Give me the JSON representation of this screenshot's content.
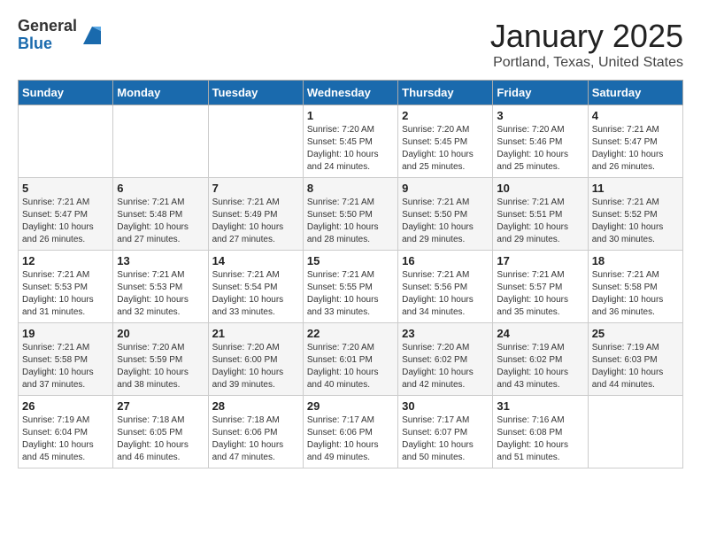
{
  "logo": {
    "general": "General",
    "blue": "Blue"
  },
  "title": "January 2025",
  "location": "Portland, Texas, United States",
  "days_of_week": [
    "Sunday",
    "Monday",
    "Tuesday",
    "Wednesday",
    "Thursday",
    "Friday",
    "Saturday"
  ],
  "weeks": [
    [
      {
        "day": "",
        "info": ""
      },
      {
        "day": "",
        "info": ""
      },
      {
        "day": "",
        "info": ""
      },
      {
        "day": "1",
        "sunrise": "7:20 AM",
        "sunset": "5:45 PM",
        "daylight": "10 hours and 24 minutes."
      },
      {
        "day": "2",
        "sunrise": "7:20 AM",
        "sunset": "5:45 PM",
        "daylight": "10 hours and 25 minutes."
      },
      {
        "day": "3",
        "sunrise": "7:20 AM",
        "sunset": "5:46 PM",
        "daylight": "10 hours and 25 minutes."
      },
      {
        "day": "4",
        "sunrise": "7:21 AM",
        "sunset": "5:47 PM",
        "daylight": "10 hours and 26 minutes."
      }
    ],
    [
      {
        "day": "5",
        "sunrise": "7:21 AM",
        "sunset": "5:47 PM",
        "daylight": "10 hours and 26 minutes."
      },
      {
        "day": "6",
        "sunrise": "7:21 AM",
        "sunset": "5:48 PM",
        "daylight": "10 hours and 27 minutes."
      },
      {
        "day": "7",
        "sunrise": "7:21 AM",
        "sunset": "5:49 PM",
        "daylight": "10 hours and 27 minutes."
      },
      {
        "day": "8",
        "sunrise": "7:21 AM",
        "sunset": "5:50 PM",
        "daylight": "10 hours and 28 minutes."
      },
      {
        "day": "9",
        "sunrise": "7:21 AM",
        "sunset": "5:50 PM",
        "daylight": "10 hours and 29 minutes."
      },
      {
        "day": "10",
        "sunrise": "7:21 AM",
        "sunset": "5:51 PM",
        "daylight": "10 hours and 29 minutes."
      },
      {
        "day": "11",
        "sunrise": "7:21 AM",
        "sunset": "5:52 PM",
        "daylight": "10 hours and 30 minutes."
      }
    ],
    [
      {
        "day": "12",
        "sunrise": "7:21 AM",
        "sunset": "5:53 PM",
        "daylight": "10 hours and 31 minutes."
      },
      {
        "day": "13",
        "sunrise": "7:21 AM",
        "sunset": "5:53 PM",
        "daylight": "10 hours and 32 minutes."
      },
      {
        "day": "14",
        "sunrise": "7:21 AM",
        "sunset": "5:54 PM",
        "daylight": "10 hours and 33 minutes."
      },
      {
        "day": "15",
        "sunrise": "7:21 AM",
        "sunset": "5:55 PM",
        "daylight": "10 hours and 33 minutes."
      },
      {
        "day": "16",
        "sunrise": "7:21 AM",
        "sunset": "5:56 PM",
        "daylight": "10 hours and 34 minutes."
      },
      {
        "day": "17",
        "sunrise": "7:21 AM",
        "sunset": "5:57 PM",
        "daylight": "10 hours and 35 minutes."
      },
      {
        "day": "18",
        "sunrise": "7:21 AM",
        "sunset": "5:58 PM",
        "daylight": "10 hours and 36 minutes."
      }
    ],
    [
      {
        "day": "19",
        "sunrise": "7:21 AM",
        "sunset": "5:58 PM",
        "daylight": "10 hours and 37 minutes."
      },
      {
        "day": "20",
        "sunrise": "7:20 AM",
        "sunset": "5:59 PM",
        "daylight": "10 hours and 38 minutes."
      },
      {
        "day": "21",
        "sunrise": "7:20 AM",
        "sunset": "6:00 PM",
        "daylight": "10 hours and 39 minutes."
      },
      {
        "day": "22",
        "sunrise": "7:20 AM",
        "sunset": "6:01 PM",
        "daylight": "10 hours and 40 minutes."
      },
      {
        "day": "23",
        "sunrise": "7:20 AM",
        "sunset": "6:02 PM",
        "daylight": "10 hours and 42 minutes."
      },
      {
        "day": "24",
        "sunrise": "7:19 AM",
        "sunset": "6:02 PM",
        "daylight": "10 hours and 43 minutes."
      },
      {
        "day": "25",
        "sunrise": "7:19 AM",
        "sunset": "6:03 PM",
        "daylight": "10 hours and 44 minutes."
      }
    ],
    [
      {
        "day": "26",
        "sunrise": "7:19 AM",
        "sunset": "6:04 PM",
        "daylight": "10 hours and 45 minutes."
      },
      {
        "day": "27",
        "sunrise": "7:18 AM",
        "sunset": "6:05 PM",
        "daylight": "10 hours and 46 minutes."
      },
      {
        "day": "28",
        "sunrise": "7:18 AM",
        "sunset": "6:06 PM",
        "daylight": "10 hours and 47 minutes."
      },
      {
        "day": "29",
        "sunrise": "7:17 AM",
        "sunset": "6:06 PM",
        "daylight": "10 hours and 49 minutes."
      },
      {
        "day": "30",
        "sunrise": "7:17 AM",
        "sunset": "6:07 PM",
        "daylight": "10 hours and 50 minutes."
      },
      {
        "day": "31",
        "sunrise": "7:16 AM",
        "sunset": "6:08 PM",
        "daylight": "10 hours and 51 minutes."
      },
      {
        "day": "",
        "info": ""
      }
    ]
  ]
}
